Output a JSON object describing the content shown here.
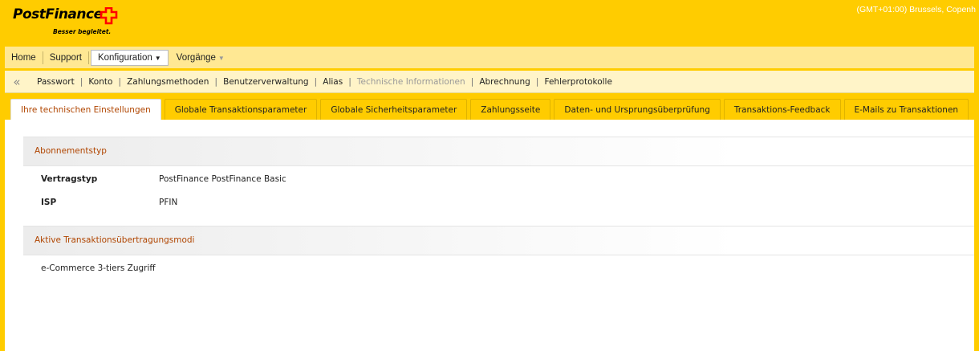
{
  "header": {
    "logo_text": "PostFinance",
    "logo_tagline": "Besser begleitet.",
    "timezone": "(GMT+01:00) Brussels, Copenh",
    "brand_color": "#ffcc00",
    "logo_cross_color": "#ff0000"
  },
  "main_menu": {
    "items": [
      {
        "label": "Home"
      },
      {
        "label": "Support"
      },
      {
        "label": "Konfiguration",
        "active": true
      },
      {
        "label": "Vorgänge"
      }
    ]
  },
  "sub_menu": {
    "collapse_icon": "double-chevron-left-icon",
    "items": [
      {
        "label": "Passwort"
      },
      {
        "label": "Konto"
      },
      {
        "label": "Zahlungsmethoden"
      },
      {
        "label": "Benutzerverwaltung"
      },
      {
        "label": "Alias"
      },
      {
        "label": "Technische Informationen",
        "disabled": true
      },
      {
        "label": "Abrechnung"
      },
      {
        "label": "Fehlerprotokolle"
      }
    ],
    "separator": "|"
  },
  "tabs": [
    {
      "label": "Ihre technischen Einstellungen",
      "active": true
    },
    {
      "label": "Globale Transaktionsparameter"
    },
    {
      "label": "Globale Sicherheitsparameter"
    },
    {
      "label": "Zahlungsseite"
    },
    {
      "label": "Daten- und Ursprungsüberprüfung"
    },
    {
      "label": "Transaktions-Feedback"
    },
    {
      "label": "E-Mails zu Transaktionen"
    }
  ],
  "content": {
    "subscription_section": {
      "title": "Abonnementstyp",
      "rows": [
        {
          "label": "Vertragstyp",
          "value": "PostFinance PostFinance Basic"
        },
        {
          "label": "ISP",
          "value": "PFIN"
        }
      ]
    },
    "modes_section": {
      "title": "Aktive Transaktionsübertragungsmodi",
      "items": [
        "e-Commerce 3-tiers Zugriff"
      ]
    },
    "accent_color": "#b04500"
  }
}
